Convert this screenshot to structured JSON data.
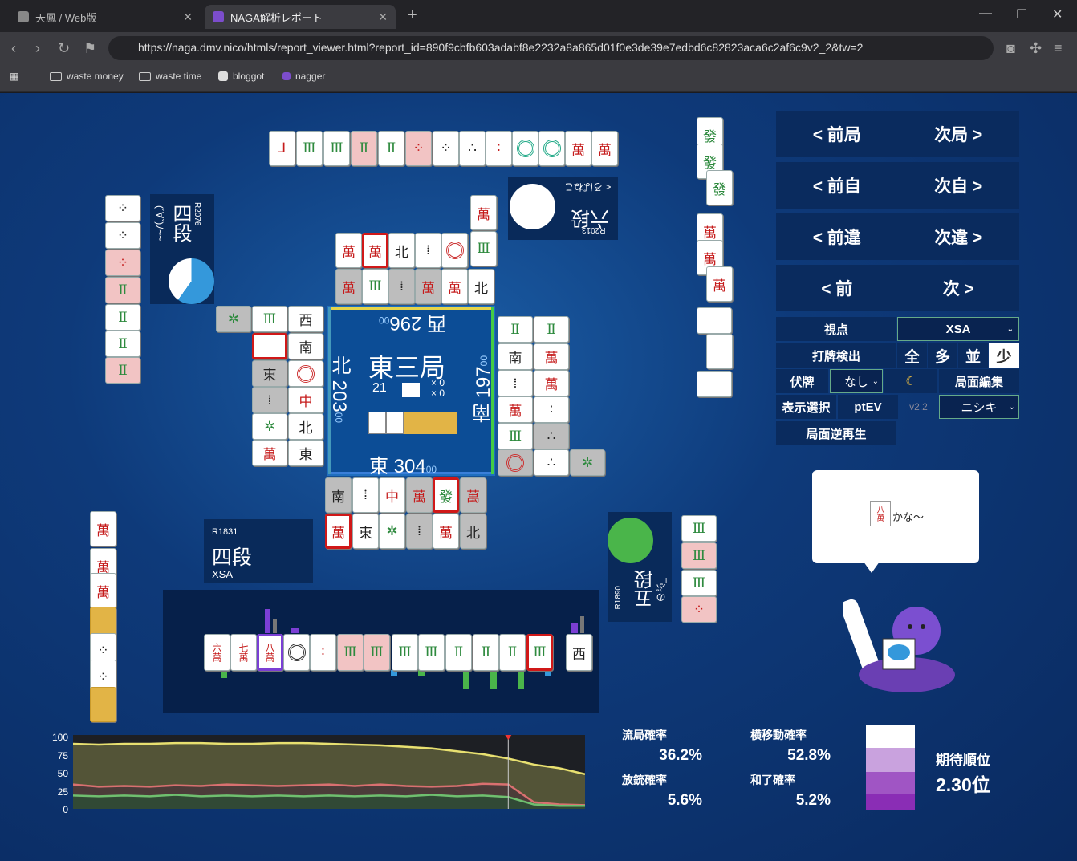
{
  "browser": {
    "tabs": [
      {
        "label": "天鳳 / Web版"
      },
      {
        "label": "NAGA解析レポート"
      }
    ],
    "url": "https://naga.dmv.nico/htmls/report_viewer.html?report_id=890f9cbfb603adabf8e2232a8a865d01f0e3de39e7edbd6c82823aca6c2af6c9v2_2&tw=2",
    "bookmarks": [
      "waste money",
      "waste time",
      "bloggot",
      "nagger"
    ]
  },
  "board": {
    "round": "東三局",
    "honba": "21",
    "counters": [
      "× 0",
      "× 0"
    ],
    "scores": {
      "east": {
        "label": "東 304",
        "sub": "00"
      },
      "south": {
        "label": "南 197",
        "sub": "00"
      },
      "west": {
        "label": "西 296",
        "sub": "00"
      },
      "north": {
        "label": "北 203",
        "sub": "00"
      }
    },
    "players": {
      "self": {
        "rate": "R1831",
        "rank": "四段",
        "name": "XSA"
      },
      "right": {
        "rate": "R1890",
        "rank": "五段",
        "name": "のぶ_"
      },
      "top": {
        "rate": "R2013",
        "rank": "六段",
        "name": "< ろばねこ"
      },
      "left": {
        "rate": "R2076",
        "rank": "四段",
        "name": "(´∀`)ﾉ~~"
      }
    },
    "hand": [
      "六萬",
      "七萬",
      "八萬",
      "1p",
      "2p",
      "3s",
      "3s",
      "6s",
      "6s",
      "7s",
      "7s",
      "7s",
      "8s"
    ],
    "draw": "西",
    "top_meld": [
      "8s",
      "9s",
      "5s",
      "5s",
      "4s",
      "6p",
      "6p",
      "5p",
      "2p",
      "1p",
      "1p",
      "1m",
      "5m",
      "5m"
    ],
    "speech": "かな〜",
    "speech_tile": "八萬"
  },
  "controls": {
    "prev_round": "< 前局",
    "next_round": "次局 >",
    "prev_self": "< 前自",
    "next_self": "次自 >",
    "prev_diff": "< 前違",
    "next_diff": "次違 >",
    "prev": "< 前",
    "next": "次 >",
    "viewpoint_label": "視点",
    "viewpoint_value": "XSA",
    "detect_label": "打牌検出",
    "detect_opts": [
      "全",
      "多",
      "並",
      "少"
    ],
    "hide_label": "伏牌",
    "hide_value": "なし",
    "moon": "☾",
    "edit_label": "局面編集",
    "display_label": "表示選択",
    "ptev_label": "ptEV",
    "version": "v2.2",
    "model_value": "ニシキ",
    "reverse_label": "局面逆再生"
  },
  "stats": {
    "ryukyoku_label": "流局確率",
    "ryukyoku_value": "36.2%",
    "yoko_label": "横移動確率",
    "yoko_value": "52.8%",
    "houju_label": "放銃確率",
    "houju_value": "5.6%",
    "hora_label": "和了確率",
    "hora_value": "5.2%",
    "rank_label": "期待順位",
    "rank_value": "2.30位"
  },
  "chart_data": {
    "type": "area",
    "yticks": [
      "100",
      "75",
      "50",
      "25",
      "0"
    ],
    "ylim": [
      0,
      100
    ],
    "series": [
      {
        "color": "#e8e070",
        "values": [
          88,
          87,
          88,
          88,
          89,
          89,
          88,
          88,
          89,
          89,
          88,
          87,
          86,
          84,
          82,
          78,
          74,
          68,
          60,
          55,
          47
        ]
      },
      {
        "color": "#d97070",
        "values": [
          33,
          30,
          31,
          30,
          32,
          31,
          33,
          32,
          31,
          32,
          33,
          31,
          33,
          31,
          30,
          31,
          34,
          33,
          9,
          6,
          5
        ]
      },
      {
        "color": "#6fbf6f",
        "values": [
          18,
          17,
          18,
          17,
          19,
          17,
          18,
          17,
          18,
          17,
          18,
          17,
          18,
          17,
          19,
          17,
          18,
          16,
          6,
          4,
          4
        ]
      }
    ],
    "marker_index": 17
  },
  "colors": {
    "bg": "#0e3a7a",
    "panel": "#0a2b5e",
    "accent_green": "#4ab54a",
    "accent_blue": "#3498db"
  }
}
